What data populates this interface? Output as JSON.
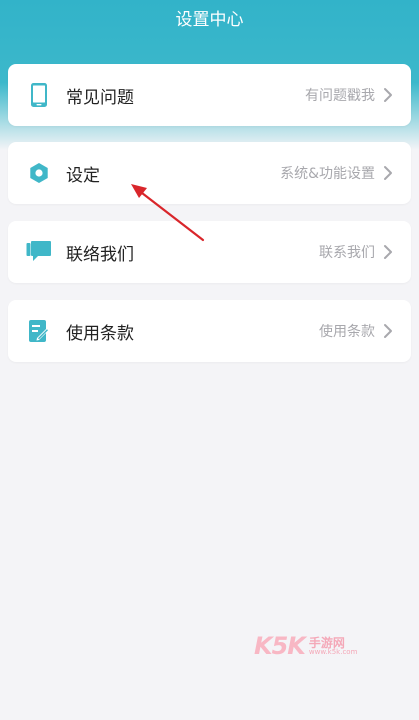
{
  "header": {
    "title": "设置中心"
  },
  "menu": {
    "items": [
      {
        "label": "常见问题",
        "hint": "有问题戳我",
        "icon": "phone-icon"
      },
      {
        "label": "设定",
        "hint": "系统&功能设置",
        "icon": "gear-icon"
      },
      {
        "label": "联络我们",
        "hint": "联系我们",
        "icon": "chat-bubble-icon"
      },
      {
        "label": "使用条款",
        "hint": "使用条款",
        "icon": "document-edit-icon"
      }
    ]
  },
  "colors": {
    "accent": "#3cb8cb",
    "icon": "#40b7c8",
    "annotation_arrow": "#d9262b",
    "hint": "#a8a8ad"
  },
  "watermark": {
    "brand": "K5K",
    "name": "手游网",
    "url": "www.k5k.com"
  }
}
